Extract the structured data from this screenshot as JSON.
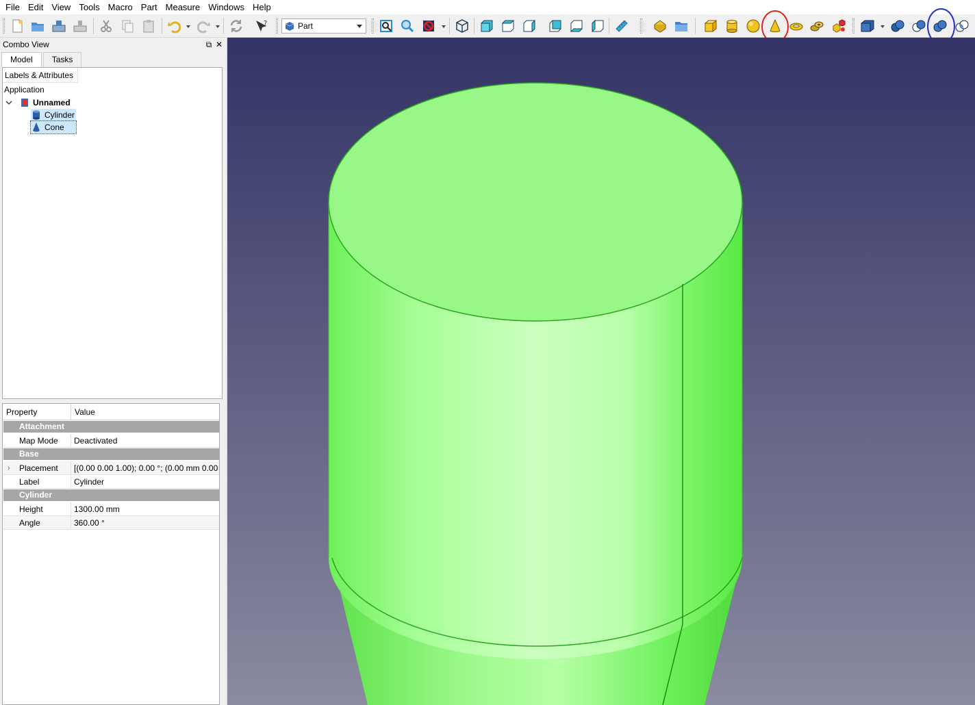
{
  "menu": [
    "File",
    "Edit",
    "View",
    "Tools",
    "Macro",
    "Part",
    "Measure",
    "Windows",
    "Help"
  ],
  "toolbar": {
    "workbench": "Part",
    "highlights": {
      "red_circle_tool": "cone-tool",
      "blue_circle_tool": "intersection-tool"
    },
    "colors": {
      "red": "#e0201c",
      "blue": "#1f2fc8"
    }
  },
  "combo": {
    "title": "Combo View",
    "tabs": [
      "Model",
      "Tasks"
    ],
    "tree_header": "Labels & Attributes",
    "application": "Application",
    "document": "Unnamed",
    "objects": [
      "Cylinder",
      "Cone"
    ]
  },
  "properties": {
    "headers": [
      "Property",
      "Value"
    ],
    "groups": [
      "Attachment",
      "Base",
      "Cylinder"
    ],
    "rows": [
      {
        "name": "Map Mode",
        "value": "Deactivated"
      },
      {
        "name": "Placement",
        "value": "[(0.00 0.00 1.00); 0.00 °; (0.00 mm  0.00..."
      },
      {
        "name": "Label",
        "value": "Cylinder"
      },
      {
        "name": "Height",
        "value": "1300.00 mm"
      },
      {
        "name": "Angle",
        "value": "360.00 °"
      }
    ]
  },
  "view3d": {
    "background_top": "#333366",
    "background_bottom": "#8a8aa0",
    "shape_color": "#88ff77"
  }
}
